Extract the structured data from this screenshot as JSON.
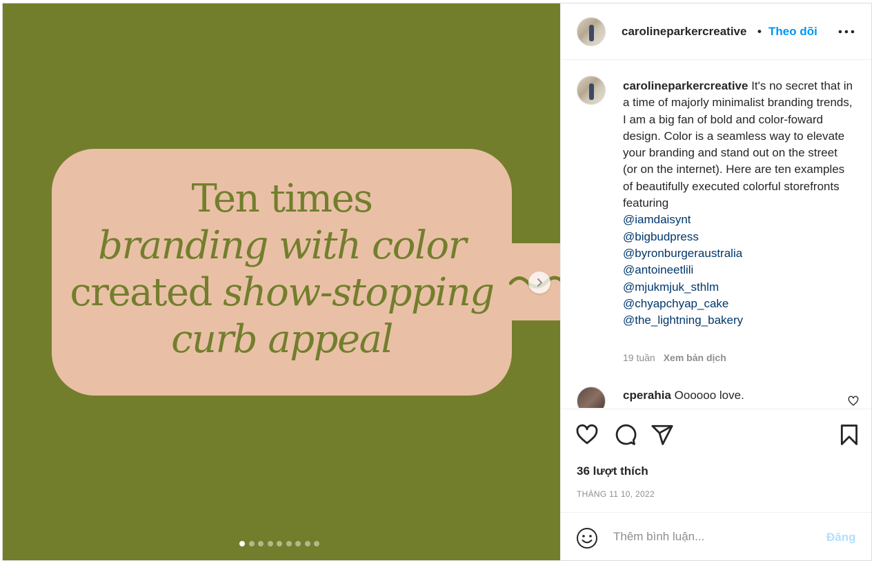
{
  "slide": {
    "line1": "Ten times",
    "line2": "branding with color",
    "line3a": "created ",
    "line3b": "show-stopping",
    "line4": "curb appeal",
    "next_icon": "chevron-right-icon",
    "dot_count": 9,
    "active_dot": 1,
    "background_color": "#737e2d",
    "card_color": "#e9c0a6"
  },
  "header": {
    "username": "carolineparkercreative",
    "separator": "•",
    "follow_label": "Theo dõi",
    "more_icon": "more-horizontal-icon"
  },
  "caption": {
    "username": "carolineparkercreative",
    "text": "It's no secret that in a time of majorly minimalist branding trends, I am a big fan of bold and color-foward design. Color is a seamless way to elevate your branding and stand out on the street (or on the internet). Here are ten examples of beautifully executed colorful storefronts featuring",
    "mentions": [
      "@iamdaisynt",
      "@bigbudpress",
      "@byronburgeraustralia",
      "@antoineetlili",
      "@mjukmjuk_sthlm",
      "@chyapchyap_cake",
      "@the_lightning_bakery"
    ],
    "time": "19 tuần",
    "translate_label": "Xem bản dịch"
  },
  "comment": {
    "username": "cperahia",
    "text": "Oooooo love."
  },
  "actions": {
    "likes": "36 lượt thích",
    "date": "THÁNG 11 10, 2022"
  },
  "add_comment": {
    "placeholder": "Thêm bình luận...",
    "post_label": "Đăng"
  },
  "colors": {
    "accent": "#0095f6",
    "mention": "#00376b",
    "muted": "#8e8e8e",
    "post_disabled": "#b2dffc"
  }
}
